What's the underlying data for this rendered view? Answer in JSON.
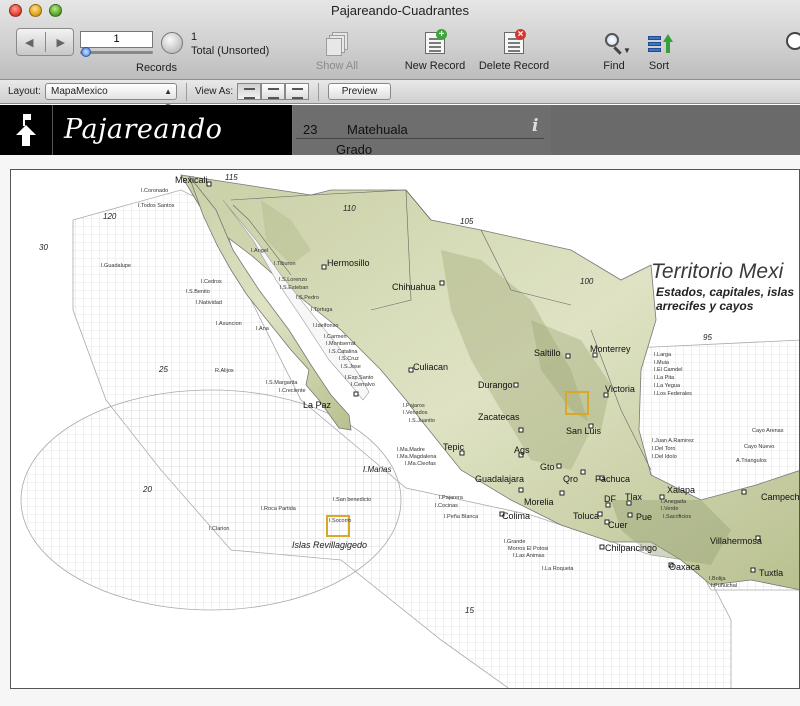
{
  "window": {
    "title": "Pajareando-Cuadrantes"
  },
  "toolbar": {
    "record_number": "1",
    "found_count": "1",
    "total_label": "Total (Unsorted)",
    "records_label": "Records",
    "show_all": "Show All",
    "new_record": "New Record",
    "delete_record": "Delete Record",
    "find": "Find",
    "sort": "Sort"
  },
  "layoutbar": {
    "layout_label": "Layout:",
    "layout_value": "MapaMexico",
    "view_as_label": "View As:",
    "preview": "Preview"
  },
  "header": {
    "logo": "Pajareando",
    "record_id": "23",
    "city": "Matehuala",
    "field_label": "Grado",
    "info_icon": "i"
  },
  "map": {
    "title": "Territorio Mexi",
    "subtitle_1": "Estados, capitales, islas",
    "subtitle_2": "arrecifes y cayos",
    "islands_label": "Islas Revillagigedo",
    "marias_label": "I.Marias",
    "longitudes": [
      {
        "label": "115"
      },
      {
        "label": "110"
      },
      {
        "label": "105"
      },
      {
        "label": "100"
      },
      {
        "label": "95"
      },
      {
        "label": "120"
      }
    ],
    "latitudes": [
      {
        "label": "30"
      },
      {
        "label": "25"
      },
      {
        "label": "20"
      },
      {
        "label": "15"
      }
    ],
    "cities": [
      {
        "name": "Mexicali"
      },
      {
        "name": "Hermosillo"
      },
      {
        "name": "Chihuahua"
      },
      {
        "name": "La Paz"
      },
      {
        "name": "Culiacan"
      },
      {
        "name": "Durango"
      },
      {
        "name": "Saltillo"
      },
      {
        "name": "Monterrey"
      },
      {
        "name": "Victoria"
      },
      {
        "name": "Zacatecas"
      },
      {
        "name": "San Luis"
      },
      {
        "name": "Tepic"
      },
      {
        "name": "Ags"
      },
      {
        "name": "Gto"
      },
      {
        "name": "Qro"
      },
      {
        "name": "Pachuca"
      },
      {
        "name": "Guadalajara"
      },
      {
        "name": "Morelia"
      },
      {
        "name": "DF"
      },
      {
        "name": "Tlax"
      },
      {
        "name": "Colima"
      },
      {
        "name": "Toluca"
      },
      {
        "name": "Cuer"
      },
      {
        "name": "Pue"
      },
      {
        "name": "Xalapa"
      },
      {
        "name": "Chilpancingo"
      },
      {
        "name": "Oaxaca"
      },
      {
        "name": "Villahermosa"
      },
      {
        "name": "Tuxtla"
      },
      {
        "name": "Campeche"
      }
    ],
    "islands": [
      {
        "name": "I.Coronado"
      },
      {
        "name": "I.Todos Santos"
      },
      {
        "name": "I.Guadalupe"
      },
      {
        "name": "I.Cedros"
      },
      {
        "name": "I.S.Benito"
      },
      {
        "name": "I.Natividad"
      },
      {
        "name": "I.Asuncion"
      },
      {
        "name": "I.Angel"
      },
      {
        "name": "I.Tiburon"
      },
      {
        "name": "I.S.Lorenzo"
      },
      {
        "name": "I.S.Esteban"
      },
      {
        "name": "I.S.Pedro"
      },
      {
        "name": "I.Tortuga"
      },
      {
        "name": "I.Ana"
      },
      {
        "name": "I.Idelfonso"
      },
      {
        "name": "I.Carmen"
      },
      {
        "name": "I.Montserrat"
      },
      {
        "name": "I.S.Catalina"
      },
      {
        "name": "I.S.Cruz"
      },
      {
        "name": "I.S.Jose"
      },
      {
        "name": "I.Esp.Santo"
      },
      {
        "name": "I.Cerralvo"
      },
      {
        "name": "I.S.Margarita"
      },
      {
        "name": "I.Creciente"
      },
      {
        "name": "R.Alijos"
      },
      {
        "name": "I.Pajaros"
      },
      {
        "name": "I.Venados"
      },
      {
        "name": "I.S.Juanito"
      },
      {
        "name": "I.Ma.Madre"
      },
      {
        "name": "I.Ma.Magdalena"
      },
      {
        "name": "I.Ma.Cleofas"
      },
      {
        "name": "I.San benedicto"
      },
      {
        "name": "I.Roca Partida"
      },
      {
        "name": "I.Socorro"
      },
      {
        "name": "I.Clarion"
      },
      {
        "name": "I.Pajarera"
      },
      {
        "name": "I.Cocinas"
      },
      {
        "name": "I.Peña Blanca"
      },
      {
        "name": "I.Grande"
      },
      {
        "name": "Morros El Potosi"
      },
      {
        "name": "I.Las Animas"
      },
      {
        "name": "I.La Roqueta"
      },
      {
        "name": "I.Larga"
      },
      {
        "name": "I.Muia"
      },
      {
        "name": "I.El Camdel"
      },
      {
        "name": "I.La Pita"
      },
      {
        "name": "I.La Yegua"
      },
      {
        "name": "I.Los Federales"
      },
      {
        "name": "I.Juan A.Ramirez"
      },
      {
        "name": "I.Del Toro"
      },
      {
        "name": "I.Del Idolo"
      },
      {
        "name": "Cayo Arenas"
      },
      {
        "name": "Cayo Nuevo"
      },
      {
        "name": "A.Triangulos"
      },
      {
        "name": "I.Anegada"
      },
      {
        "name": "I.Verde"
      },
      {
        "name": "I.Sacrificios"
      },
      {
        "name": "I.Bolija"
      },
      {
        "name": "I.Puñuchal"
      }
    ]
  },
  "colors": {
    "land_light": "#dfe3c4",
    "land_dark": "#9fa97a",
    "grid": "#c9c9c9",
    "highlight": "#d9a72a",
    "header_black": "#000000"
  }
}
